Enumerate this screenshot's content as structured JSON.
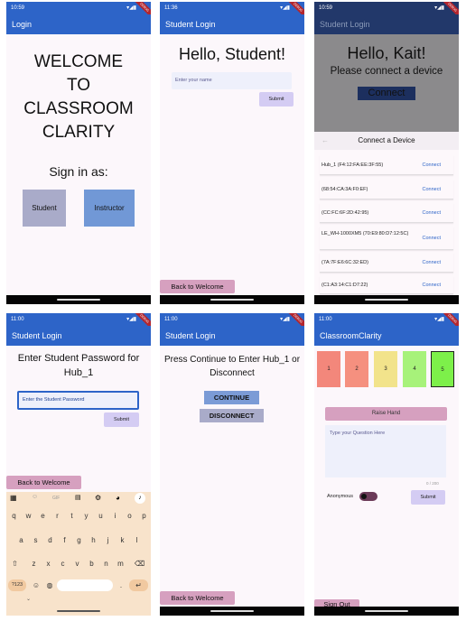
{
  "screens": [
    {
      "time": "10:59",
      "appbar_title": "Login",
      "welcome_lines": [
        "WELCOME",
        "TO",
        "CLASSROOM",
        "CLARITY"
      ],
      "sign_in_as": "Sign in as:",
      "student_button": "Student",
      "instructor_button": "Instructor"
    },
    {
      "time": "11:36",
      "appbar_title": "Student Login",
      "greeting": "Hello, Student!",
      "name_placeholder": "Enter your name",
      "submit": "Submit",
      "back": "Back to Welcome"
    },
    {
      "time": "10:59",
      "appbar_title": "Student Login",
      "greeting": "Hello, Kait!",
      "prompt": "Please connect a device",
      "connect_button": "Connect",
      "dialog_title": "Connect a Device",
      "connect_link": "Connect",
      "devices": [
        "Hub_1 (F4:12:FA:EE:3F:55)",
        "(68:54:CA:3A:F0:EF)",
        "(CC:FC:6F:2D:42:95)",
        "LE_WH-1000XM5 (70:E9:80:D7:12:5C)",
        "(7A:7F:E6:6C:32:ED)",
        "(C1:A3:14:C1:D7:22)"
      ]
    },
    {
      "time": "11:00",
      "appbar_title": "Student Login",
      "title": "Enter Student Password for Hub_1",
      "password_placeholder": "Enter the Student Password",
      "submit": "Submit",
      "back": "Back to Welcome",
      "keyboard_row1": [
        "q",
        "w",
        "e",
        "r",
        "t",
        "y",
        "u",
        "i",
        "o",
        "p"
      ],
      "keyboard_row2": [
        "a",
        "s",
        "d",
        "f",
        "g",
        "h",
        "j",
        "k",
        "l"
      ],
      "keyboard_row3": [
        "z",
        "x",
        "c",
        "v",
        "b",
        "n",
        "m"
      ],
      "numbers_key": "?123",
      "gif_key": "GIF"
    },
    {
      "time": "11:00",
      "appbar_title": "Student Login",
      "title": "Press Continue to Enter Hub_1 or Disconnect",
      "continue_button": "CONTINUE",
      "disconnect_button": "DISCONNECT",
      "back": "Back to Welcome"
    },
    {
      "time": "11:00",
      "appbar_title": "ClassroomClarity",
      "tiles": [
        {
          "label": "1",
          "color": "#f3877b"
        },
        {
          "label": "2",
          "color": "#f5907f"
        },
        {
          "label": "3",
          "color": "#f2e38b"
        },
        {
          "label": "4",
          "color": "#a7f27a"
        },
        {
          "label": "5",
          "color": "#7df04a"
        }
      ],
      "raise_hand": "Raise Hand",
      "question_placeholder": "Type your Question Here",
      "counter": "0 / 200",
      "anonymous_label": "Anonymous",
      "submit": "Submit",
      "sign_out": "Sign Out"
    }
  ]
}
